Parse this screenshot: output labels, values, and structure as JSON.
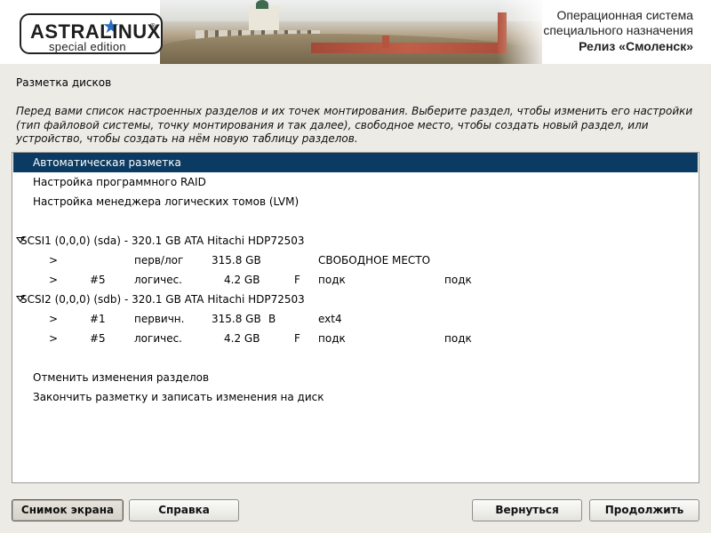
{
  "header": {
    "logo_brand": "ASTRALINUX",
    "logo_registered": "®",
    "logo_edition": "special edition",
    "title_line1": "Операционная система",
    "title_line2": "специального назначения",
    "title_line3": "Релиз «Смоленск»",
    "logo_star_color": "#2a6cc0"
  },
  "main": {
    "section_title": "Разметка дисков",
    "description": "Перед вами список настроенных разделов и их точек монтирования. Выберите раздел, чтобы изменить его настройки (тип файловой системы, точку монтирования и так далее), свободное место, чтобы создать новый раздел, или устройство, чтобы создать на нём новую таблицу разделов.",
    "options": {
      "auto": "Автоматическая разметка",
      "raid": "Настройка программного RAID",
      "lvm": "Настройка менеджера логических томов (LVM)",
      "undo": "Отменить изменения разделов",
      "finish": "Закончить разметку и записать изменения на диск"
    },
    "disk1": {
      "name": "SCSI1 (0,0,0) (sda) - 320.1 GB ATA Hitachi HDP72503",
      "partitions": [
        {
          "marker": ">",
          "num": "",
          "type": "перв/лог",
          "size": "315.8 GB",
          "flag": "",
          "fs": "СВОБОДНОЕ МЕСТО",
          "mount": ""
        },
        {
          "marker": ">",
          "num": "#5",
          "type": "логичес.",
          "size": "4.2 GB",
          "flag": "F",
          "fs": "подк",
          "mount": "подк"
        }
      ]
    },
    "disk2": {
      "name": "SCSI2 (0,0,0) (sdb) - 320.1 GB ATA Hitachi HDP72503",
      "partitions": [
        {
          "marker": ">",
          "num": "#1",
          "type": "первичн.",
          "size": "315.8 GB",
          "flag": "B",
          "fs": "ext4",
          "mount": ""
        },
        {
          "marker": ">",
          "num": "#5",
          "type": "логичес.",
          "size": "4.2 GB",
          "flag": "F",
          "fs": "подк",
          "mount": "подк"
        }
      ]
    },
    "selected_color": "#0b3b62"
  },
  "buttons": {
    "screenshot": "Снимок экрана",
    "help": "Справка",
    "back": "Вернуться",
    "continue": "Продолжить"
  }
}
